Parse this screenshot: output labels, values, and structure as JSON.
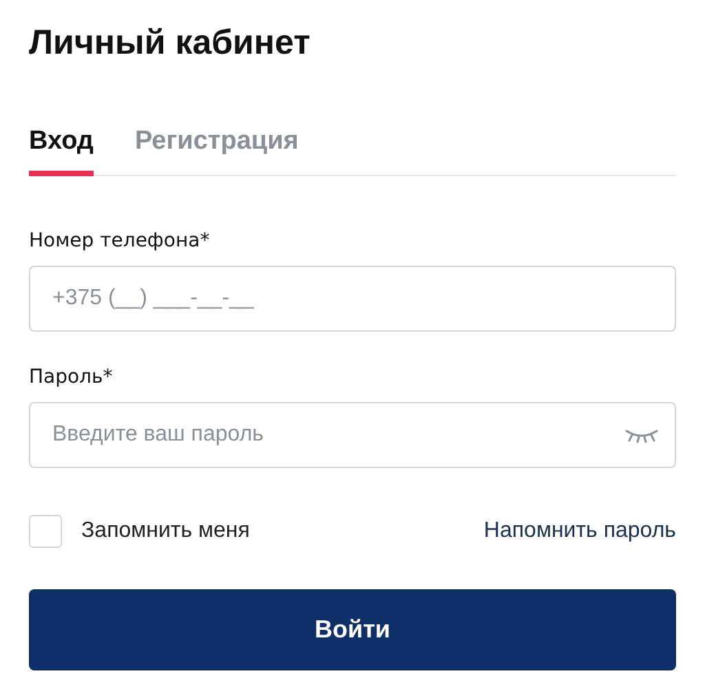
{
  "title": "Личный кабинет",
  "tabs": [
    {
      "label": "Вход",
      "selected": true
    },
    {
      "label": "Регистрация",
      "selected": false
    }
  ],
  "fields": [
    {
      "label": "Номер телефона*",
      "placeholder": "+375 (__) ___-__-__",
      "kind": "text"
    },
    {
      "label": "Пароль*",
      "placeholder": "Введите ваш пароль",
      "kind": "password"
    }
  ],
  "remember": {
    "label": "Запомнить меня",
    "checked": false
  },
  "forgot_link": "Напомнить пароль",
  "submit": "Войти"
}
